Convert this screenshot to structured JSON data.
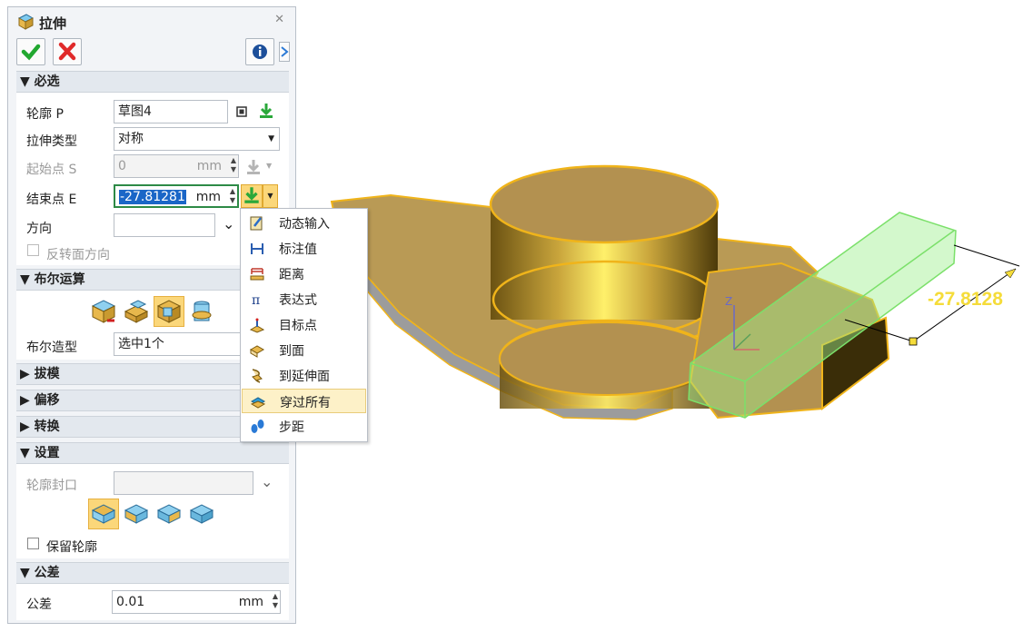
{
  "dialog": {
    "title": "拉伸",
    "close_glyph": "✕",
    "icons": {
      "ok": "check-icon",
      "cancel": "x-icon",
      "info": "info-icon",
      "help": "help-icon"
    }
  },
  "required": {
    "header": "必选",
    "profile": {
      "label": "轮廓 P",
      "value": "草图4"
    },
    "extrude_type": {
      "label": "拉伸类型",
      "value": "对称"
    },
    "start_point": {
      "label": "起始点 S",
      "value": "0",
      "unit": "mm"
    },
    "end_point": {
      "label": "结束点 E",
      "value": "-27.81281",
      "unit": "mm"
    },
    "direction": {
      "label": "方向",
      "value": ""
    },
    "reverse": {
      "label": "反转面方向",
      "checked": false
    }
  },
  "boolean": {
    "header": "布尔运算",
    "selected_index": 2,
    "shape_label": "布尔造型",
    "shape_value": "选中1个"
  },
  "collapsed_sections": [
    "拔模",
    "偏移",
    "转换"
  ],
  "settings": {
    "header": "设置",
    "cap_label": "轮廓封口",
    "cap_value": "",
    "keep_profile": {
      "label": "保留轮廓",
      "checked": false
    }
  },
  "tolerance": {
    "header": "公差",
    "label": "公差",
    "value": "0.01",
    "unit": "mm"
  },
  "menu": {
    "items": [
      {
        "label": "动态输入",
        "icon": "pencil-icon"
      },
      {
        "label": "标注值",
        "icon": "dimension-icon"
      },
      {
        "label": "距离",
        "icon": "distance-icon"
      },
      {
        "label": "表达式",
        "icon": "pi-icon"
      },
      {
        "label": "目标点",
        "icon": "target-point-icon"
      },
      {
        "label": "到面",
        "icon": "to-face-icon"
      },
      {
        "label": "到延伸面",
        "icon": "to-extended-face-icon"
      },
      {
        "label": "穿过所有",
        "icon": "through-all-icon"
      },
      {
        "label": "步距",
        "icon": "steps-icon"
      }
    ],
    "highlighted_index": 7
  },
  "viewport": {
    "dimension_value": "-27.8128",
    "axis_label": "Z"
  }
}
